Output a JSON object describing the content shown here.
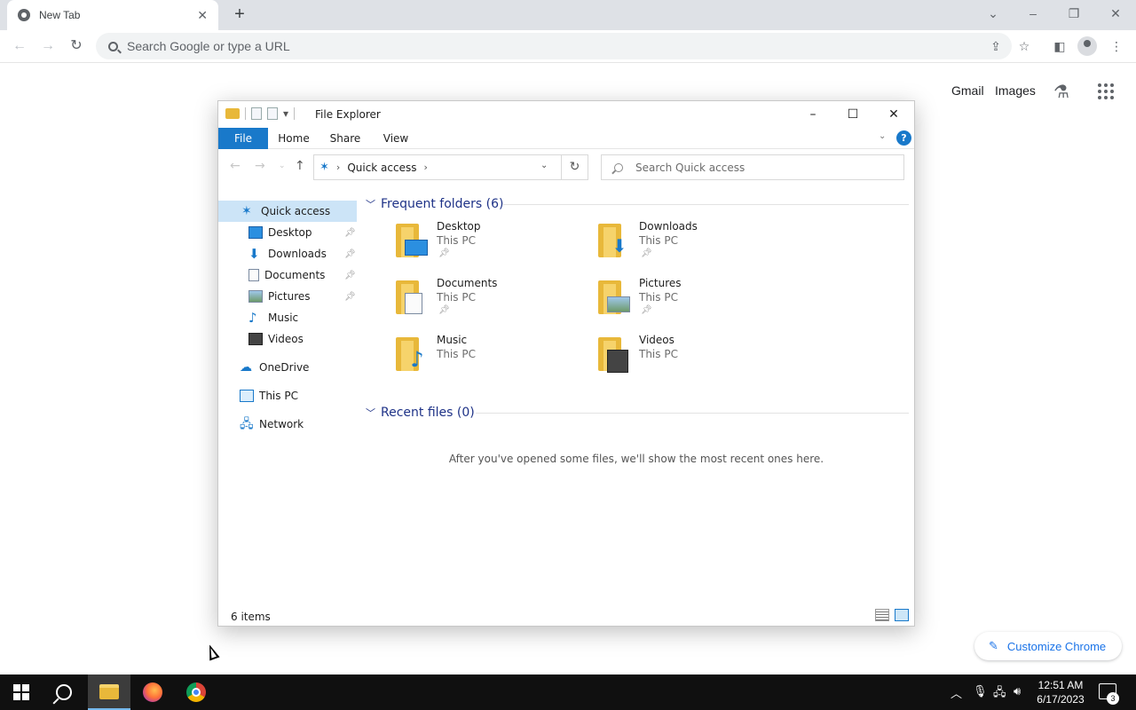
{
  "chrome": {
    "tab_title": "New Tab",
    "omnibox_placeholder": "Search Google or type a URL",
    "ntp_links": {
      "gmail": "Gmail",
      "images": "Images"
    },
    "customize_label": "Customize Chrome"
  },
  "explorer": {
    "title": "File Explorer",
    "ribbon_tabs": [
      "File",
      "Home",
      "Share",
      "View"
    ],
    "address": {
      "location": "Quick access"
    },
    "search_placeholder": "Search Quick access",
    "nav": {
      "quick_access": "Quick access",
      "pinned": [
        "Desktop",
        "Downloads",
        "Documents",
        "Pictures"
      ],
      "unpinned": [
        "Music",
        "Videos"
      ],
      "onedrive": "OneDrive",
      "this_pc": "This PC",
      "network": "Network"
    },
    "frequent_header": "Frequent folders (6)",
    "folders": [
      {
        "name": "Desktop",
        "location": "This PC",
        "pinned": true,
        "icon": "desktop-icon"
      },
      {
        "name": "Downloads",
        "location": "This PC",
        "pinned": true,
        "icon": "downloads-icon"
      },
      {
        "name": "Documents",
        "location": "This PC",
        "pinned": true,
        "icon": "documents-icon"
      },
      {
        "name": "Pictures",
        "location": "This PC",
        "pinned": true,
        "icon": "pictures-icon"
      },
      {
        "name": "Music",
        "location": "This PC",
        "pinned": false,
        "icon": "music-icon"
      },
      {
        "name": "Videos",
        "location": "This PC",
        "pinned": false,
        "icon": "videos-icon"
      }
    ],
    "recent_header": "Recent files (0)",
    "recent_empty": "After you've opened some files, we'll show the most recent ones here.",
    "status": "6 items"
  },
  "taskbar": {
    "time": "12:51 AM",
    "date": "6/17/2023",
    "notification_count": "3"
  },
  "colors": {
    "explorer_accent": "#1979ca",
    "chrome_link": "#1a73e8",
    "taskbar": "#101010"
  }
}
